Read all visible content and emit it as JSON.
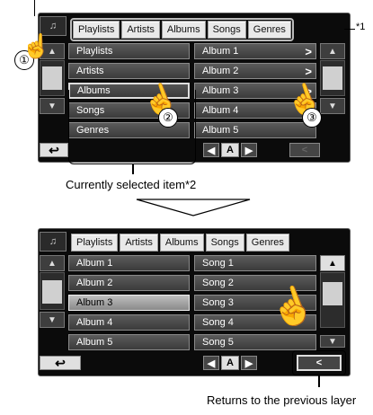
{
  "tabs": [
    "Playlists",
    "Artists",
    "Albums",
    "Songs",
    "Genres"
  ],
  "screen1": {
    "left_items": [
      "Playlists",
      "Artists",
      "Albums",
      "Songs",
      "Genres"
    ],
    "selected_left": "Albums",
    "right_items": [
      "Album 1",
      "Album 2",
      "Album 3",
      "Album 4",
      "Album 5"
    ],
    "alpha_label": "A"
  },
  "screen2": {
    "left_items": [
      "Album 1",
      "Album 2",
      "Album 3",
      "Album 4",
      "Album 5"
    ],
    "selected_left": "Album 3",
    "right_items": [
      "Song 1",
      "Song 2",
      "Song 3",
      "Song 4",
      "Song 5"
    ],
    "alpha_label": "A"
  },
  "annotations": {
    "step1": "①",
    "step2": "②",
    "step3": "③",
    "note1": "*1",
    "selected_caption": "Currently selected item*2",
    "previous_caption": "Returns to the previous layer"
  },
  "icons": [
    "music-category-icon",
    "hand-pointer-icon",
    "chevron-right-icon",
    "back-arrow-icon",
    "triangle-up-icon",
    "triangle-down-icon"
  ]
}
